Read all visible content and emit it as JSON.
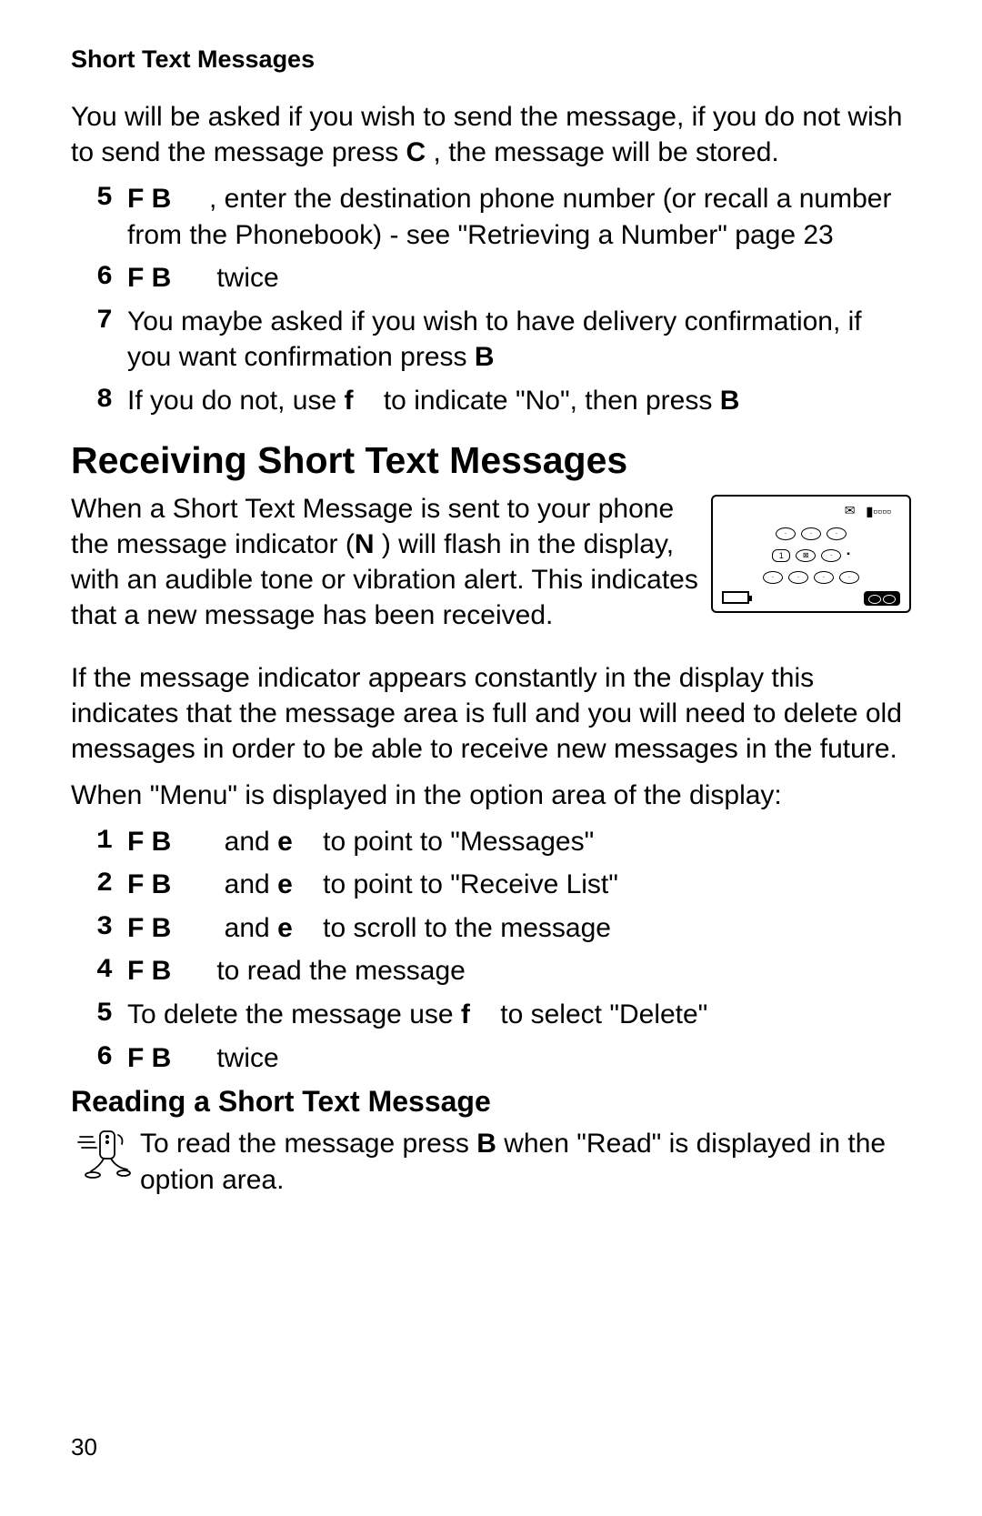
{
  "header": {
    "title": "Short Text Messages"
  },
  "intro": {
    "part1": "You will be asked if you wish to send the message, if you do not wish to send the message press ",
    "key": "C",
    "part2": " , the message will be stored."
  },
  "stepsA": [
    {
      "num": "5",
      "pre": "F B",
      "text": ", enter the destination phone number (or recall a number from the Phonebook) - see \"Retrieving a Number\" page 23"
    },
    {
      "num": "6",
      "pre": "F B",
      "text": "twice"
    },
    {
      "num": "7",
      "text_before": "You maybe asked if you wish to have delivery confirmation, if you want confirmation press ",
      "key_after": "B"
    },
    {
      "num": "8",
      "text_before": "If you do not, use ",
      "mid_key": "f",
      "text_mid": " to indicate \"No\", then press ",
      "key_after": "B"
    }
  ],
  "receiving": {
    "heading": "Receiving Short Text Messages",
    "p1a": "When a Short Text Message is sent to your phone the message indicator (",
    "p1_key": "N",
    "p1b": " ) will flash in the display, with an audible tone or vibration alert. This indicates that a new message has been received.",
    "p2": "If the message indicator appears constantly in the display this indicates that the message area is full and you will need to delete old messages in order to be able to receive new messages in the future.",
    "p3": "When \"Menu\" is displayed in the option area of the display:"
  },
  "stepsB": [
    {
      "num": "1",
      "pre": "F B",
      "mid": " and ",
      "key2": "e",
      "text": " to point to \"Messages\""
    },
    {
      "num": "2",
      "pre": "F B",
      "mid": " and ",
      "key2": "e",
      "text": " to point to \"Receive List\""
    },
    {
      "num": "3",
      "pre": "F B",
      "mid": " and ",
      "key2": "e",
      "text": " to scroll to the message"
    },
    {
      "num": "4",
      "pre": "F B",
      "text": "to read the message"
    },
    {
      "num": "5",
      "text_before": "To delete the message use ",
      "mid_key": "f",
      "text": " to select \"Delete\""
    },
    {
      "num": "6",
      "pre": "F B",
      "text": "twice"
    }
  ],
  "reading": {
    "heading": "Reading a Short Text Message",
    "tip_a": "To read the message press ",
    "tip_key": "B",
    "tip_b": " when \"Read\" is displayed in the option area."
  },
  "pageNumber": "30"
}
